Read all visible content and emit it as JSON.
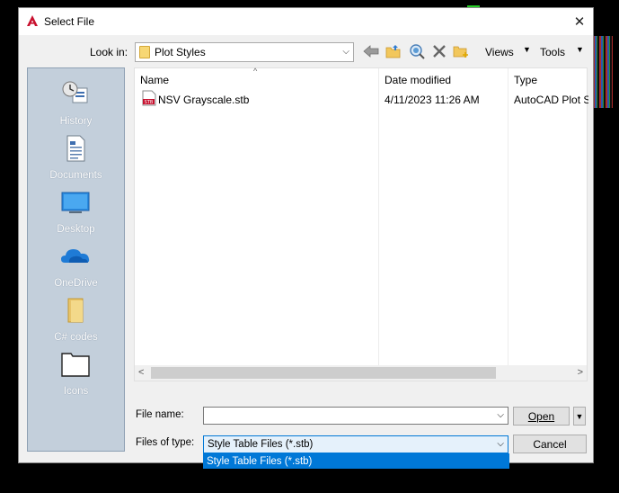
{
  "window": {
    "title": "Select File"
  },
  "lookin": {
    "label": "Look in:",
    "value": "Plot Styles"
  },
  "toolbar": {
    "back_icon": "back-arrow-icon",
    "up_icon": "folder-up-icon",
    "search_icon": "search-web-icon",
    "delete_icon": "delete-x-icon",
    "new_folder_icon": "new-folder-icon",
    "views_label": "Views",
    "tools_label": "Tools"
  },
  "places": [
    {
      "label": "History",
      "icon": "history-icon"
    },
    {
      "label": "Documents",
      "icon": "documents-icon"
    },
    {
      "label": "Desktop",
      "icon": "desktop-icon"
    },
    {
      "label": "OneDrive",
      "icon": "onedrive-icon"
    },
    {
      "label": "C# codes",
      "icon": "folder-icon"
    },
    {
      "label": "Icons",
      "icon": "folder-outline-icon"
    }
  ],
  "file_list": {
    "columns": [
      "Name",
      "Date modified",
      "Type"
    ],
    "rows": [
      {
        "name": "NSV Grayscale.stb",
        "date": "4/11/2023 11:26 AM",
        "type": "AutoCAD Plot S"
      }
    ]
  },
  "form": {
    "file_name_label": "File name:",
    "file_name_value": "",
    "file_type_label": "Files of type:",
    "file_type_value": "Style Table Files (*.stb)",
    "file_type_options": [
      "Style Table Files (*.stb)"
    ]
  },
  "buttons": {
    "open": "Open",
    "cancel": "Cancel"
  },
  "colors": {
    "selection": "#0078d7",
    "places_bg": "#c3cfdb",
    "app_red": "#c8102e"
  }
}
